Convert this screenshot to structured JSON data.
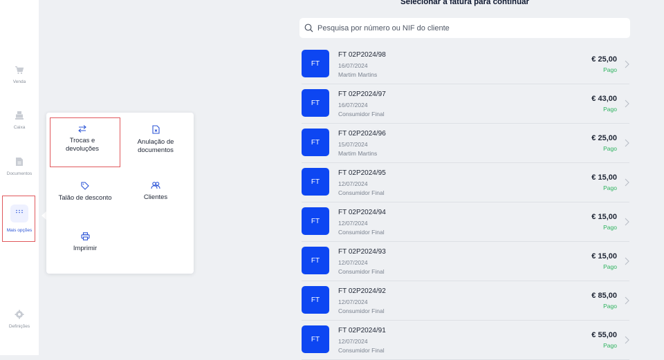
{
  "sidebar": {
    "items": [
      {
        "id": "venda",
        "label": "Venda",
        "icon": "cart-icon"
      },
      {
        "id": "caixa",
        "label": "Caixa",
        "icon": "cash-register-icon"
      },
      {
        "id": "documentos",
        "label": "Documentos",
        "icon": "document-icon"
      },
      {
        "id": "mais",
        "label": "Mais opções",
        "icon": "grid-dots-icon",
        "active": true
      },
      {
        "id": "definicoes",
        "label": "Definições",
        "icon": "gear-icon"
      }
    ]
  },
  "menu": {
    "options": [
      {
        "label": "Trocas e devoluções",
        "icon": "swap-arrows-icon"
      },
      {
        "label": "Anulação de documentos",
        "icon": "cancel-document-icon"
      },
      {
        "label": "Talão de desconto",
        "icon": "tag-icon"
      },
      {
        "label": "Clientes",
        "icon": "users-icon"
      },
      {
        "label": "Imprimir",
        "icon": "printer-icon"
      }
    ]
  },
  "main": {
    "title": "Selecionar a fatura para continuar",
    "search": {
      "placeholder": "Pesquisa por número ou NIF do cliente",
      "value": ""
    },
    "invoices": [
      {
        "badge": "FT",
        "number": "FT 02P2024/98",
        "date": "16/07/2024",
        "client": "Martim Martins",
        "amount": "€ 25,00",
        "status": "Pago"
      },
      {
        "badge": "FT",
        "number": "FT 02P2024/97",
        "date": "16/07/2024",
        "client": "Consumidor Final",
        "amount": "€ 43,00",
        "status": "Pago"
      },
      {
        "badge": "FT",
        "number": "FT 02P2024/96",
        "date": "15/07/2024",
        "client": "Martim Martins",
        "amount": "€ 25,00",
        "status": "Pago"
      },
      {
        "badge": "FT",
        "number": "FT 02P2024/95",
        "date": "12/07/2024",
        "client": "Consumidor Final",
        "amount": "€ 15,00",
        "status": "Pago"
      },
      {
        "badge": "FT",
        "number": "FT 02P2024/94",
        "date": "12/07/2024",
        "client": "Consumidor Final",
        "amount": "€ 15,00",
        "status": "Pago"
      },
      {
        "badge": "FT",
        "number": "FT 02P2024/93",
        "date": "12/07/2024",
        "client": "Consumidor Final",
        "amount": "€ 15,00",
        "status": "Pago"
      },
      {
        "badge": "FT",
        "number": "FT 02P2024/92",
        "date": "12/07/2024",
        "client": "Consumidor Final",
        "amount": "€ 85,00",
        "status": "Pago"
      },
      {
        "badge": "FT",
        "number": "FT 02P2024/91",
        "date": "12/07/2024",
        "client": "Consumidor Final",
        "amount": "€ 55,00",
        "status": "Pago"
      }
    ]
  },
  "colors": {
    "accent": "#0d46f2",
    "paid": "#2bb25c",
    "highlight": "#e0575b",
    "background": "#eef0f3"
  }
}
